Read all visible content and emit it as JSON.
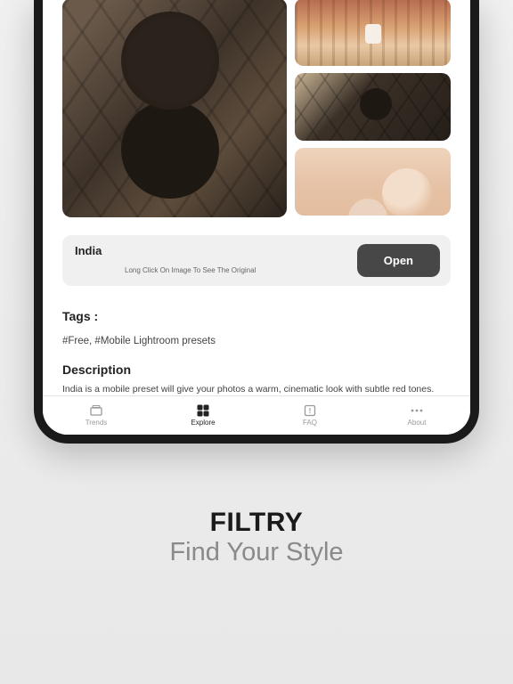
{
  "preset": {
    "name": "India",
    "hint": "Long Click On Image To See The Original",
    "open_label": "Open"
  },
  "tags": {
    "label": "Tags :",
    "value": "#Free, #Mobile Lightroom presets"
  },
  "description": {
    "label": "Description",
    "text": "India is a mobile preset will give your photos a warm, cinematic look with subtle red tones."
  },
  "tabs": {
    "trends": "Trends",
    "explore": "Explore",
    "faq": "FAQ",
    "about": "About"
  },
  "marketing": {
    "brand": "FILTRY",
    "tagline": "Find Your Style"
  }
}
